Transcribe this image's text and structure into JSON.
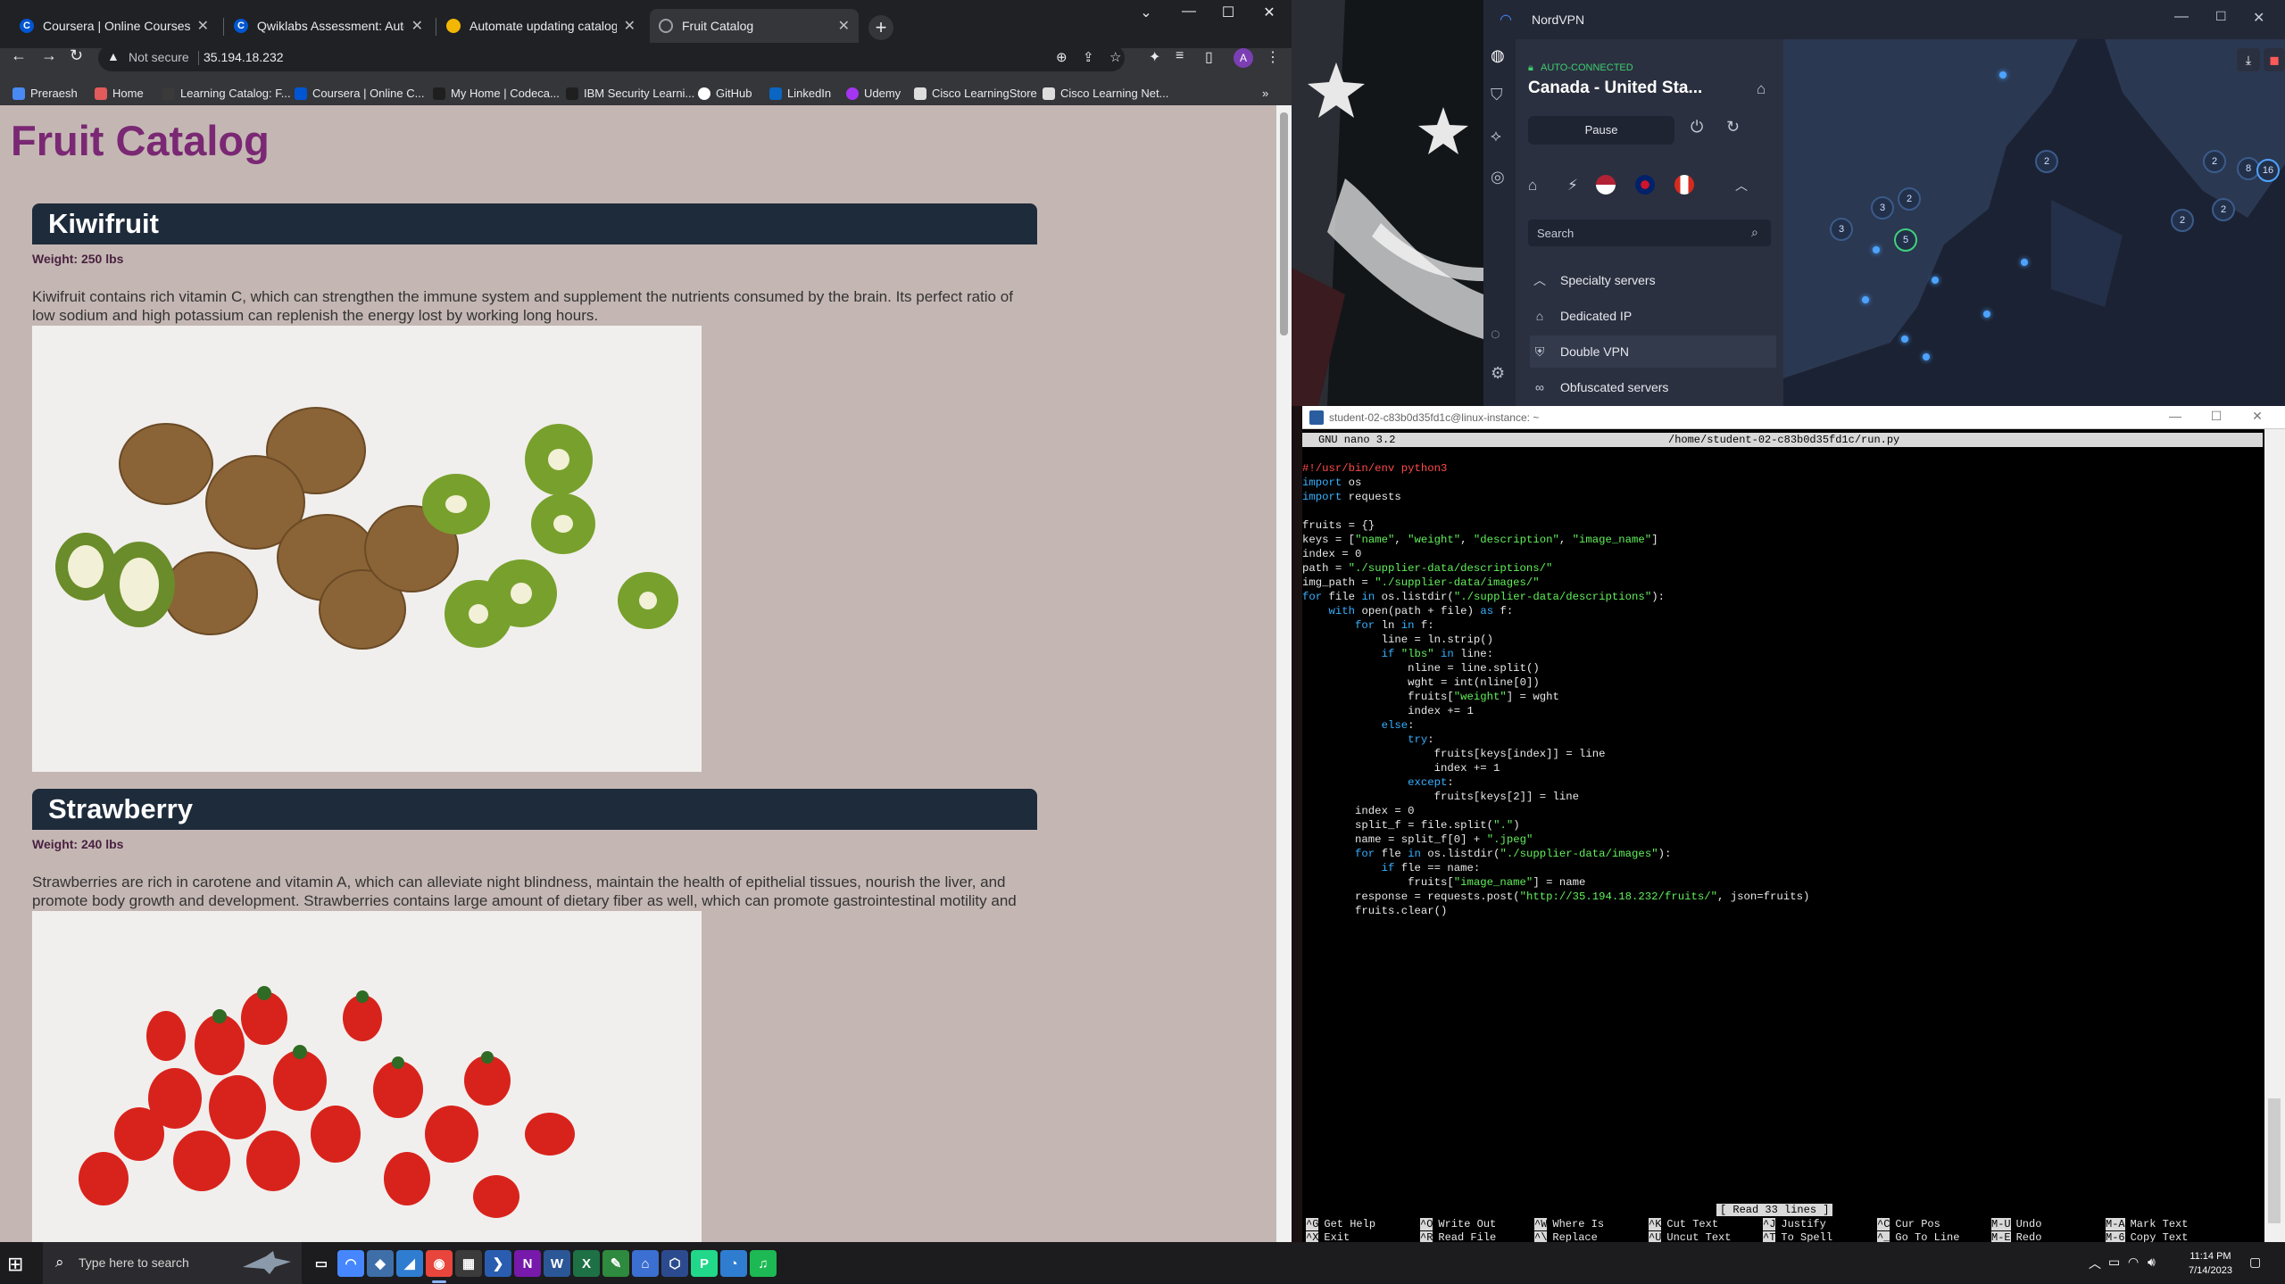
{
  "chrome": {
    "tabs": [
      {
        "label": "Coursera | Online Courses & Cre",
        "favicon": "coursera-icon",
        "color": "#0056d2"
      },
      {
        "label": "Qwiklabs Assessment: Automate",
        "favicon": "coursera-icon",
        "color": "#0056d2"
      },
      {
        "label": "Automate updating catalog infor",
        "favicon": "qwiklabs-icon",
        "color": "#f2b705"
      },
      {
        "label": "Fruit Catalog",
        "favicon": "globe-icon",
        "color": "#9aa0a6"
      }
    ],
    "address": {
      "security": "Not secure",
      "url": "35.194.18.232"
    },
    "profile_initial": "A",
    "bookmarks": [
      {
        "label": "Preraesh",
        "icon": "bookmark-icon",
        "color": "#4a8af4"
      },
      {
        "label": "Home",
        "icon": "home-icon",
        "color": "#e15b5b"
      },
      {
        "label": "Learning Catalog: F...",
        "icon": "catalog-icon",
        "color": "#3a3a3a"
      },
      {
        "label": "Coursera | Online C...",
        "icon": "coursera-icon",
        "color": "#0056d2"
      },
      {
        "label": "My Home | Codeca...",
        "icon": "codecademy-icon",
        "color": "#1f1f1f"
      },
      {
        "label": "IBM Security Learni...",
        "icon": "ibm-icon",
        "color": "#1f1f1f"
      },
      {
        "label": "GitHub",
        "icon": "github-icon",
        "color": "#ffffff"
      },
      {
        "label": "LinkedIn",
        "icon": "linkedin-icon",
        "color": "#0a66c2"
      },
      {
        "label": "Udemy",
        "icon": "udemy-icon",
        "color": "#a435f0"
      },
      {
        "label": "Cisco LearningStore",
        "icon": "cisco-icon",
        "color": "#dddddd"
      },
      {
        "label": "Cisco Learning Net...",
        "icon": "cisco-icon",
        "color": "#dddddd"
      }
    ],
    "page": {
      "title": "Fruit Catalog",
      "fruits": [
        {
          "name": "Kiwifruit",
          "weight": "Weight: 250 lbs",
          "description": "Kiwifruit contains rich vitamin C, which can strengthen the immune system and supplement the nutrients consumed by the brain. Its perfect ratio of low sodium and high potassium can replenish the energy lost by working long hours."
        },
        {
          "name": "Strawberry",
          "weight": "Weight: 240 lbs",
          "description": "Strawberries are rich in carotene and vitamin A, which can alleviate night blindness, maintain the health of epithelial tissues, nourish the liver, and promote body growth and development. Strawberries contains large amount of dietary fiber as well, which can promote gastrointestinal motility and food digestion in the gastrointestinal tract."
        }
      ]
    }
  },
  "nordvpn": {
    "title": "NordVPN",
    "status": "AUTO-CONNECTED",
    "server": "Canada - United Sta...",
    "pause_label": "Pause",
    "search_placeholder": "Search",
    "specialty_label": "Specialty servers",
    "items": [
      "Dedicated IP",
      "Double VPN",
      "Obfuscated servers"
    ],
    "map_counts": [
      "2",
      "3",
      "2",
      "5",
      "3",
      "2",
      "2",
      "8",
      "16",
      "2"
    ]
  },
  "terminal": {
    "title": "student-02-c83b0d35fd1c@linux-instance: ~",
    "nano_version": "GNU nano 3.2",
    "file_path": "/home/student-02-c83b0d35fd1c/run.py",
    "status": "[ Read 33 lines ]",
    "code_lines": [
      "#!/usr/bin/env python3",
      "import os",
      "import requests",
      "",
      "fruits = {}",
      "keys = [\"name\", \"weight\", \"description\", \"image_name\"]",
      "index = 0",
      "path = \"./supplier-data/descriptions/\"",
      "img_path = \"./supplier-data/images/\"",
      "for file in os.listdir(\"./supplier-data/descriptions\"):",
      "    with open(path + file) as f:",
      "        for ln in f:",
      "            line = ln.strip()",
      "            if \"lbs\" in line:",
      "                nline = line.split()",
      "                wght = int(nline[0])",
      "                fruits[\"weight\"] = wght",
      "                index += 1",
      "            else:",
      "                try:",
      "                    fruits[keys[index]] = line",
      "                    index += 1",
      "                except:",
      "                    fruits[keys[2]] = line",
      "        index = 0",
      "        split_f = file.split(\".\")",
      "        name = split_f[0] + \".jpeg\"",
      "        for fle in os.listdir(\"./supplier-data/images\"):",
      "            if fle == name:",
      "                fruits[\"image_name\"] = name",
      "        response = requests.post(\"http://35.194.18.232/fruits/\", json=fruits)",
      "        fruits.clear()"
    ],
    "help": [
      {
        "key1": "^G",
        "label1": "Get Help",
        "key2": "^X",
        "label2": "Exit"
      },
      {
        "key1": "^O",
        "label1": "Write Out",
        "key2": "^R",
        "label2": "Read File"
      },
      {
        "key1": "^W",
        "label1": "Where Is",
        "key2": "^\\",
        "label2": "Replace"
      },
      {
        "key1": "^K",
        "label1": "Cut Text",
        "key2": "^U",
        "label2": "Uncut Text"
      },
      {
        "key1": "^J",
        "label1": "Justify",
        "key2": "^T",
        "label2": "To Spell"
      },
      {
        "key1": "^C",
        "label1": "Cur Pos",
        "key2": "^_",
        "label2": "Go To Line"
      },
      {
        "key1": "M-U",
        "label1": "Undo",
        "key2": "M-E",
        "label2": "Redo"
      },
      {
        "key1": "M-A",
        "label1": "Mark Text",
        "key2": "M-6",
        "label2": "Copy Text"
      }
    ]
  },
  "taskbar": {
    "search_placeholder": "Type here to search",
    "time": "11:14 PM",
    "date": "7/14/2023",
    "apps": [
      {
        "name": "task-view-icon",
        "color": "#1c1b1e",
        "glyph": "▭"
      },
      {
        "name": "nordvpn-icon",
        "color": "#4687ff",
        "glyph": "◠"
      },
      {
        "name": "app-icon",
        "color": "#3f6fa8",
        "glyph": "◆"
      },
      {
        "name": "app-icon",
        "color": "#2f7dd1",
        "glyph": "◢"
      },
      {
        "name": "chrome-icon",
        "color": "#e8453c",
        "glyph": "◉"
      },
      {
        "name": "store-icon",
        "color": "#3b3b3b",
        "glyph": "▦"
      },
      {
        "name": "powershell-icon",
        "color": "#2a5db0",
        "glyph": "❯"
      },
      {
        "name": "onenote-icon",
        "color": "#7719aa",
        "glyph": "N"
      },
      {
        "name": "word-icon",
        "color": "#2b5797",
        "glyph": "W"
      },
      {
        "name": "excel-icon",
        "color": "#1e7145",
        "glyph": "X"
      },
      {
        "name": "app-icon",
        "color": "#2d8a3e",
        "glyph": "✎"
      },
      {
        "name": "network-icon",
        "color": "#3b6fd1",
        "glyph": "⌂"
      },
      {
        "name": "virtualbox-icon",
        "color": "#2c4b8f",
        "glyph": "⬡"
      },
      {
        "name": "pycharm-icon",
        "color": "#21d789",
        "glyph": "P"
      },
      {
        "name": "app-icon",
        "color": "#2f7dd1",
        "glyph": "◔"
      },
      {
        "name": "spotify-icon",
        "color": "#1db954",
        "glyph": "♫"
      }
    ]
  }
}
